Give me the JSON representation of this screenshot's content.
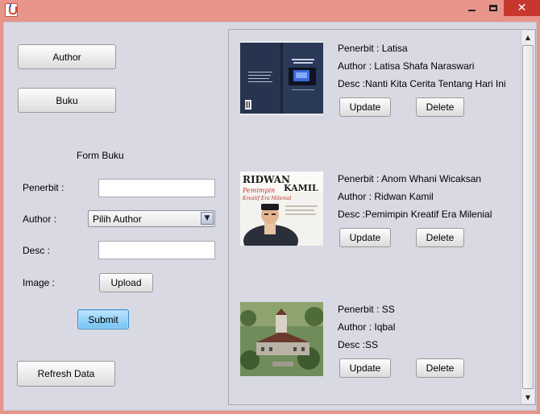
{
  "window": {
    "icon": "java-coffee-icon",
    "controls": {
      "minimize": "minimize-icon",
      "maximize": "maximize-icon",
      "close": "✕"
    }
  },
  "nav": {
    "author_label": "Author",
    "buku_label": "Buku",
    "refresh_label": "Refresh Data"
  },
  "form": {
    "title": "Form Buku",
    "penerbit_label": "Penerbit :",
    "penerbit_value": "",
    "author_label": "Author  :",
    "author_selected": "Pilih Author",
    "desc_label": "Desc :",
    "desc_value": "",
    "image_label": "Image :",
    "upload_label": "Upload",
    "submit_label": "Submit"
  },
  "books": [
    {
      "penerbit": "Penerbit : Latisa",
      "author": "Author : Latisa Shafa Naraswari",
      "desc": "Desc :Nanti Kita Cerita Tentang Hari Ini",
      "update_label": "Update",
      "delete_label": "Delete"
    },
    {
      "penerbit": "Penerbit : Anom Whani Wicaksan",
      "author": "Author : Ridwan Kamil",
      "desc": "Desc :Pemimpin Kreatif Era Milenial",
      "update_label": "Update",
      "delete_label": "Delete",
      "cover_title_1": "RIDWAN",
      "cover_title_2": "KAMIL",
      "cover_subtitle_1": "Pemimpin",
      "cover_subtitle_2": "Kreatif Era Milenial"
    },
    {
      "penerbit": "Penerbit : SS",
      "author": "Author : Iqbal",
      "desc": "Desc :SS",
      "update_label": "Update",
      "delete_label": "Delete"
    }
  ],
  "colors": {
    "titlebar": "#e9948a",
    "close": "#c7372e",
    "panel": "#d8d9e3",
    "submit": "#72c2f3"
  }
}
